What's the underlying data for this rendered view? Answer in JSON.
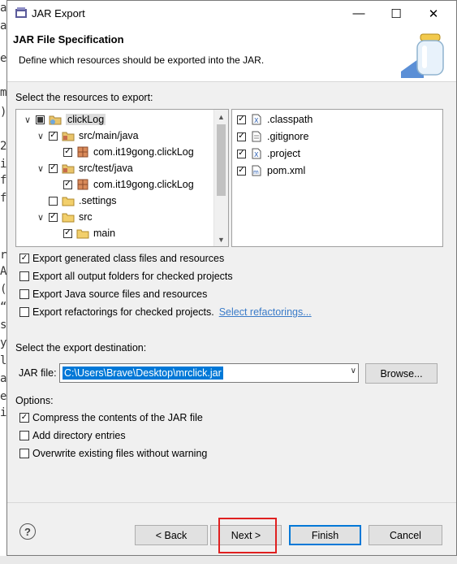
{
  "background_editor": {
    "chars": [
      "a",
      "a",
      "e",
      "m",
      ")",
      "2",
      "i",
      "f",
      "f",
      "r",
      "A",
      "(",
      "“",
      "s",
      "y",
      "l",
      "a",
      "e",
      "i"
    ]
  },
  "window": {
    "title": "JAR Export",
    "minimize_glyph": "—",
    "maximize_glyph": "☐",
    "close_glyph": "✕"
  },
  "header": {
    "title": "JAR File Specification",
    "description": "Define which resources should be exported into the JAR."
  },
  "resources": {
    "label": "Select the resources to export:",
    "tree": [
      {
        "label": "clickLog",
        "check": "partial",
        "twisty": "∨",
        "icon": "project-icon",
        "selected": true
      },
      {
        "label": "src/main/java",
        "check": "checked",
        "twisty": "∨",
        "icon": "source-folder-icon"
      },
      {
        "label": "com.it19gong.clickLog",
        "check": "checked",
        "twisty": "",
        "icon": "package-icon"
      },
      {
        "label": "src/test/java",
        "check": "checked",
        "twisty": "∨",
        "icon": "source-folder-icon"
      },
      {
        "label": "com.it19gong.clickLog",
        "check": "checked",
        "twisty": "",
        "icon": "package-icon"
      },
      {
        "label": ".settings",
        "check": "unchecked",
        "twisty": "",
        "icon": "folder-icon"
      },
      {
        "label": "src",
        "check": "checked",
        "twisty": "∨",
        "icon": "folder-icon"
      },
      {
        "label": "main",
        "check": "checked",
        "twisty": "",
        "icon": "folder-icon"
      }
    ],
    "files": [
      {
        "label": ".classpath",
        "check": "checked",
        "icon": "x-file-icon"
      },
      {
        "label": ".gitignore",
        "check": "checked",
        "icon": "text-file-icon"
      },
      {
        "label": ".project",
        "check": "checked",
        "icon": "x-file-icon"
      },
      {
        "label": "pom.xml",
        "check": "checked",
        "icon": "maven-file-icon"
      }
    ]
  },
  "export_options": [
    {
      "label": "Export generated class files and resources",
      "checked": true
    },
    {
      "label": "Export all output folders for checked projects",
      "checked": false
    },
    {
      "label": "Export Java source files and resources",
      "checked": false
    },
    {
      "label": "Export refactorings for checked projects.",
      "checked": false,
      "link": "Select refactorings..."
    }
  ],
  "destination": {
    "label": "Select the export destination:",
    "jar_label": "JAR file:",
    "jar_value": "C:\\Users\\Brave\\Desktop\\mrclick.jar",
    "browse": "Browse..."
  },
  "options": {
    "label": "Options:",
    "items": [
      {
        "label": "Compress the contents of the JAR file",
        "checked": true
      },
      {
        "label": "Add directory entries",
        "checked": false
      },
      {
        "label": "Overwrite existing files without warning",
        "checked": false
      }
    ]
  },
  "buttons": {
    "help": "?",
    "back": "< Back",
    "next": "Next >",
    "finish": "Finish",
    "cancel": "Cancel"
  }
}
